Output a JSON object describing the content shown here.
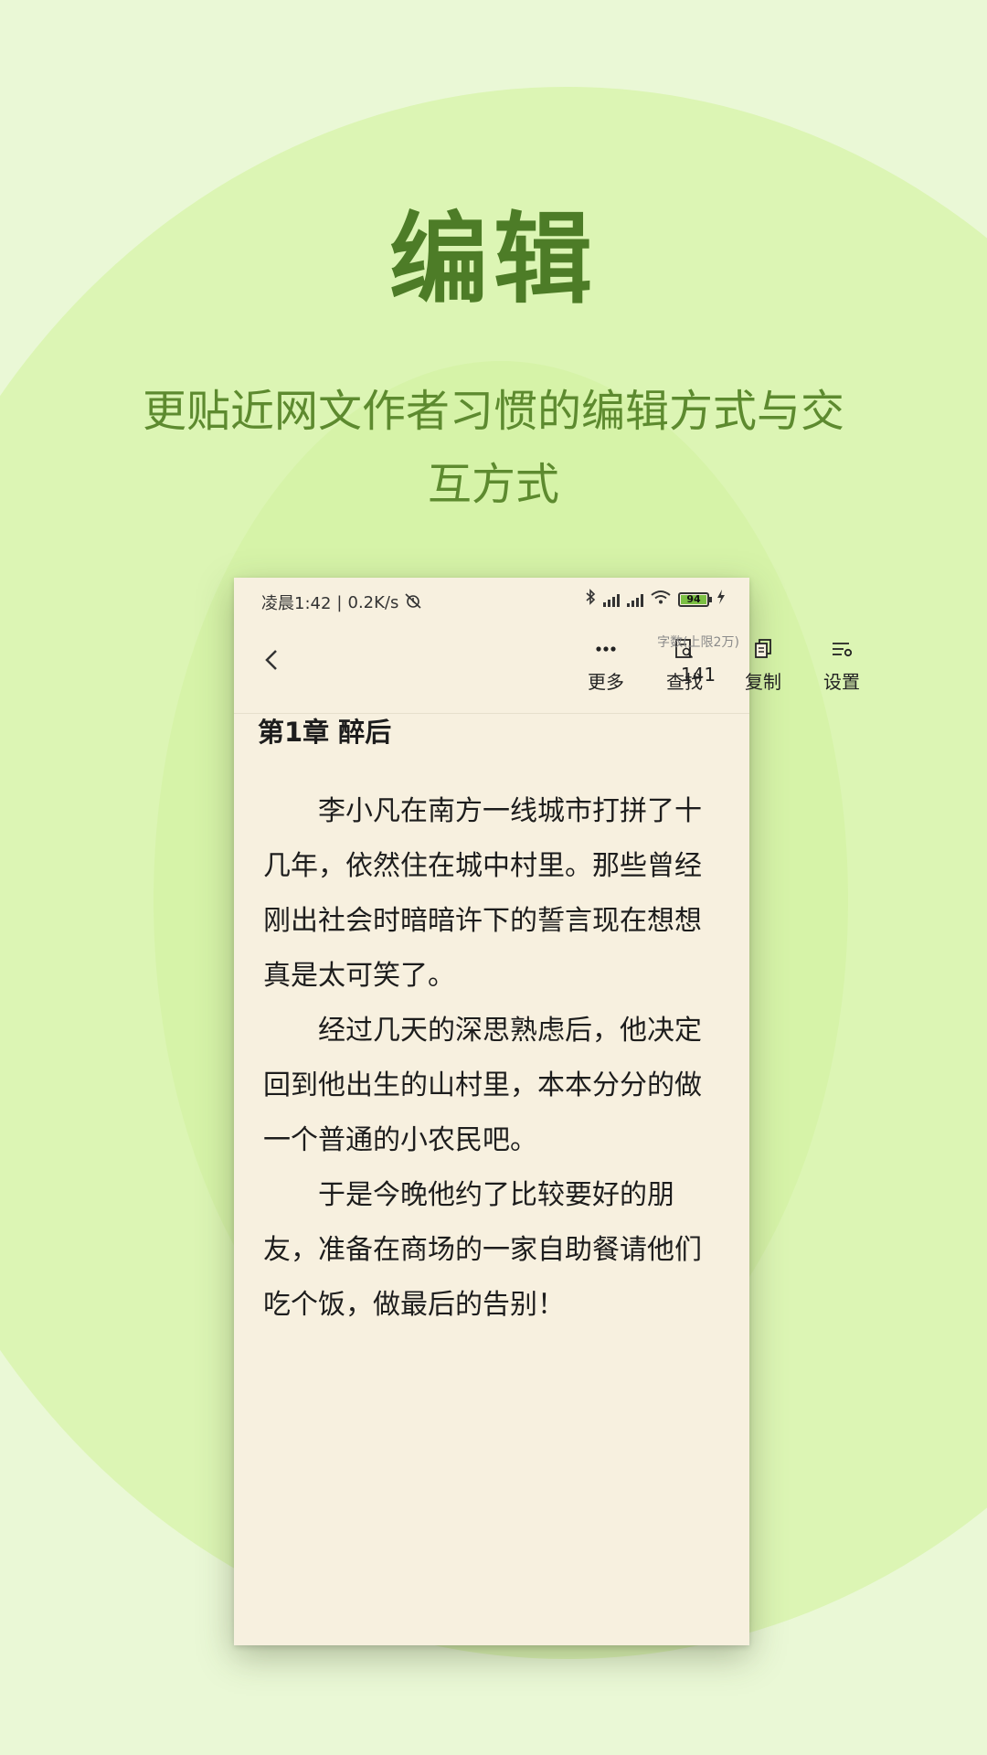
{
  "promo": {
    "headline": "编辑",
    "subline": "更贴近网文作者习惯的编辑方式与交互方式"
  },
  "statusbar": {
    "time": "凌晨1:42",
    "separator": "|",
    "speed": "0.2K/s",
    "battery": "94",
    "icons": [
      "mute-alarm-icon",
      "bluetooth-icon",
      "hd-signal-icon",
      "signal-icon",
      "wifi-icon",
      "battery-icon",
      "charging-icon"
    ]
  },
  "toolbar": {
    "back_icon": "chevron-left-icon",
    "items": [
      {
        "label": "更多",
        "icon": "more-dots-icon"
      },
      {
        "label": "查找",
        "icon": "find-icon"
      },
      {
        "label": "复制",
        "icon": "copy-icon"
      },
      {
        "label": "设置",
        "icon": "settings-icon"
      }
    ],
    "wordcount_label": "字数(上限2万)",
    "wordcount_value": "141"
  },
  "editor": {
    "chapter_title": "第1章 醉后",
    "paragraphs": [
      "李小凡在南方一线城市打拼了十几年，依然住在城中村里。那些曾经刚出社会时暗暗许下的誓言现在想想真是太可笑了。",
      "经过几天的深思熟虑后，他决定回到他出生的山村里，本本分分的做一个普通的小农民吧。",
      "于是今晚他约了比较要好的朋友，准备在商场的一家自助餐请他们吃个饭，做最后的告别！"
    ]
  },
  "colors": {
    "headline": "#4d7c27",
    "subline": "#5d8a2f",
    "background": "#eaf8d6",
    "paper": "#f7f0df"
  }
}
